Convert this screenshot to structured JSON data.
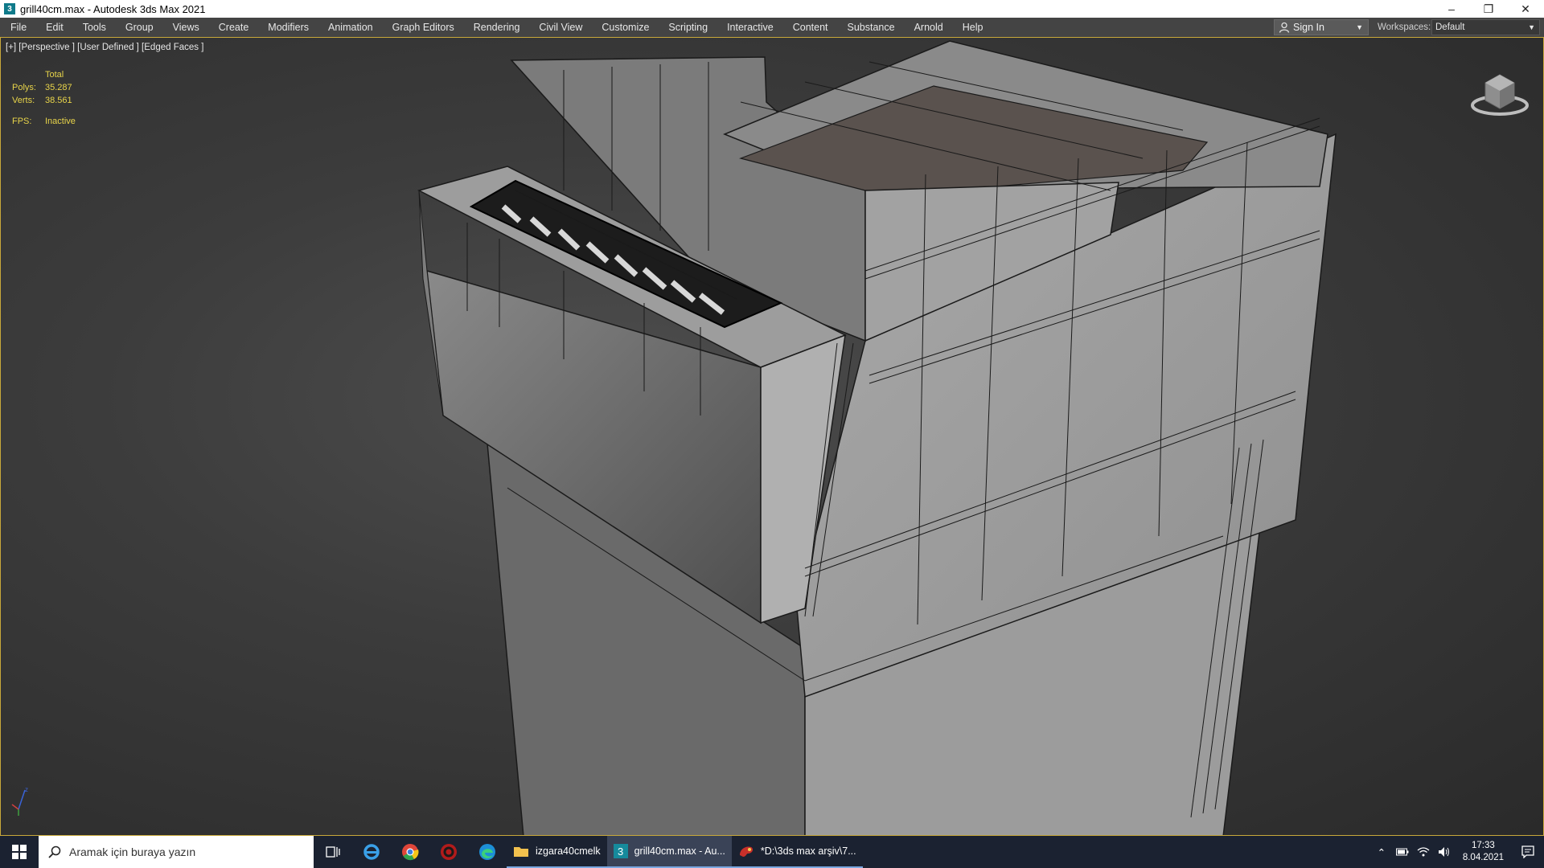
{
  "window": {
    "title": "grill40cm.max - Autodesk 3ds Max 2021",
    "app_icon_glyph": "3"
  },
  "menu": [
    "File",
    "Edit",
    "Tools",
    "Group",
    "Views",
    "Create",
    "Modifiers",
    "Animation",
    "Graph Editors",
    "Rendering",
    "Civil View",
    "Customize",
    "Scripting",
    "Interactive",
    "Content",
    "Substance",
    "Arnold",
    "Help"
  ],
  "account": {
    "signin_label": "Sign In"
  },
  "workspace": {
    "label": "Workspaces:",
    "value": "Default"
  },
  "viewport": {
    "label": "[+] [Perspective ] [User Defined ] [Edged Faces ]",
    "stats": {
      "header": "Total",
      "polys_label": "Polys:",
      "polys_value": "35.287",
      "verts_label": "Verts:",
      "verts_value": "38.561",
      "fps_label": "FPS:",
      "fps_value": "Inactive"
    }
  },
  "taskbar": {
    "search_placeholder": "Aramak için buraya yazın",
    "apps": [
      {
        "label": "izgara40cmelk",
        "icon": "folder-icon"
      },
      {
        "label": "grill40cm.max - Au...",
        "icon": "3dsmax-icon"
      },
      {
        "label": "*D:\\3ds max arşiv\\7...",
        "icon": "paint-icon"
      }
    ],
    "time": "17:33",
    "date": "8.04.2021"
  },
  "colors": {
    "accent_border": "#c8a83a",
    "stats_text": "#e8d44a",
    "taskbar_bg": "#1b2231"
  }
}
